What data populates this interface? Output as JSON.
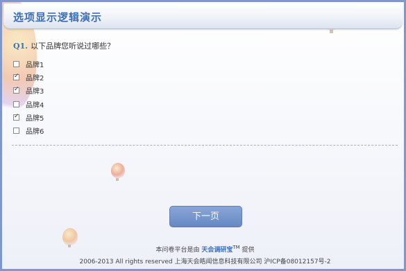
{
  "header": {
    "title": "选项显示逻辑演示"
  },
  "question": {
    "number": "Q1.",
    "text": "以下品牌您听说过哪些？"
  },
  "options": [
    {
      "label": "品牌1",
      "checked": false
    },
    {
      "label": "品牌2",
      "checked": true
    },
    {
      "label": "品牌3",
      "checked": true
    },
    {
      "label": "品牌4",
      "checked": false
    },
    {
      "label": "品牌5",
      "checked": true
    },
    {
      "label": "品牌6",
      "checked": false
    }
  ],
  "next_button": {
    "label": "下一页"
  },
  "footer": {
    "prefix": "本问卷平台是由",
    "brand": "天会调研宝",
    "tm": "TM",
    "suffix": "提供",
    "copyright": "2006-2013 All rights reserved 上海天会皓闻信息科技有限公司 沪ICP备08012157号-2"
  }
}
